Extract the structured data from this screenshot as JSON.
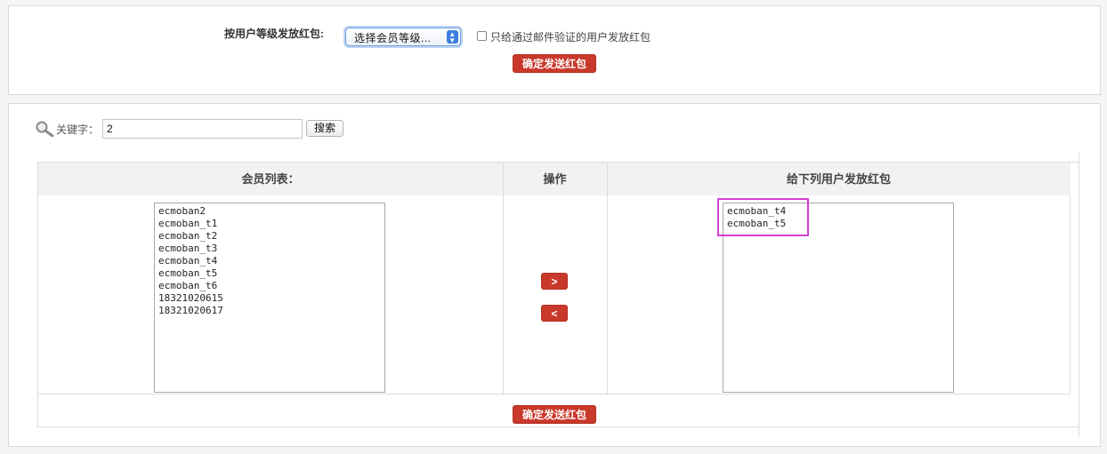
{
  "level_section": {
    "label": "按用户等级发放红包:",
    "select_value": "选择会员等级...",
    "email_checkbox_label": "只给通过邮件验证的用户发放红包",
    "email_checked": false,
    "submit_label": "确定发送红包"
  },
  "search": {
    "label": "关键字：",
    "value": "2",
    "button_label": "搜索"
  },
  "grid": {
    "headers": [
      "会员列表：",
      "操作",
      "给下列用户发放红包"
    ],
    "members": [
      "ecmoban2",
      "ecmoban_t1",
      "ecmoban_t2",
      "ecmoban_t3",
      "ecmoban_t4",
      "ecmoban_t5",
      "ecmoban_t6",
      "18321020615",
      "18321020617"
    ],
    "selected": [
      "ecmoban_t4",
      "ecmoban_t5"
    ],
    "add_label": ">",
    "remove_label": "<",
    "submit_label": "确定发送红包"
  },
  "icons": {
    "search": "search-icon",
    "select_arrows": "updown-arrows-icon"
  },
  "colors": {
    "accent_red": "#c9392b",
    "highlight": "#d43fd4",
    "select_focus": "#3d7fe0"
  }
}
